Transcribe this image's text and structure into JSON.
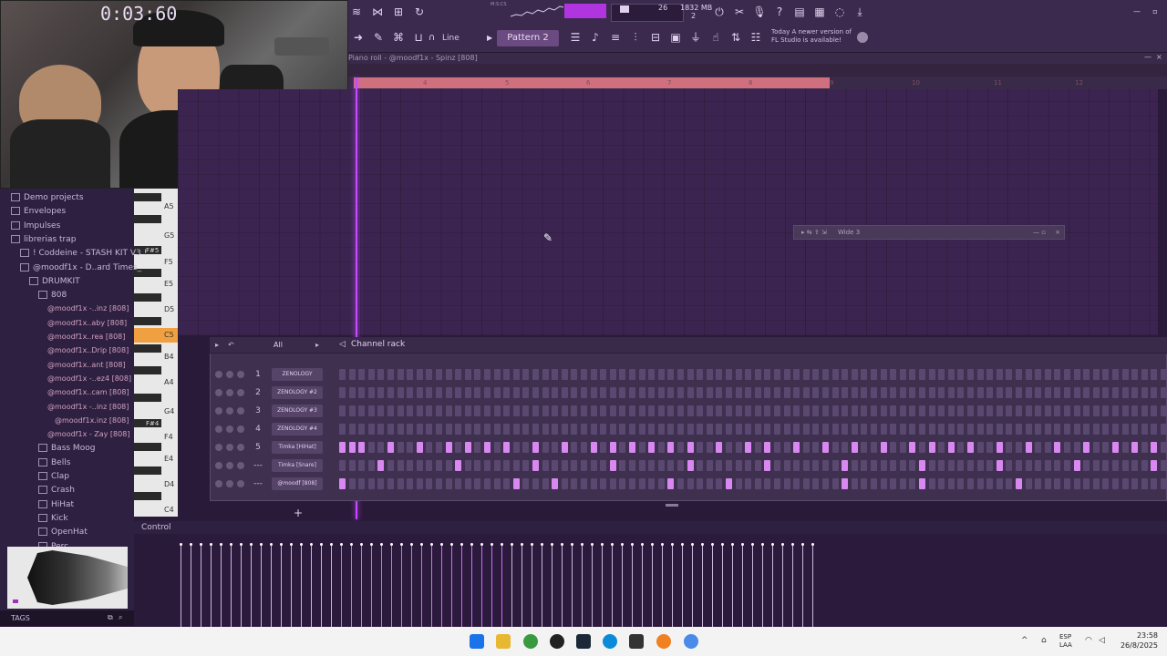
{
  "toolbar": {
    "time": "0:03:60",
    "time_unit": "M:S:CS",
    "pattern": "Pattern 2",
    "snap": "Line",
    "cpu_value": "26",
    "memory": "1832 MB",
    "memory_sub": "2",
    "update_date": "Today",
    "update_msg": "A newer version of FL Studio is available!"
  },
  "pianoroll": {
    "title": "Piano roll - @moodf1x - Spinz [808]",
    "ruler": [
      "4",
      "5",
      "6",
      "7",
      "8",
      "9",
      "10",
      "11",
      "12"
    ],
    "floating_title": "Wide 3"
  },
  "keys": {
    "labels": [
      "A5",
      "G5",
      "F5",
      "E5",
      "D5",
      "C5",
      "B4",
      "A4",
      "G4",
      "F4",
      "E4",
      "D4",
      "C4"
    ],
    "black_labels": [
      "F#5",
      "F#4"
    ]
  },
  "browser": {
    "folders": [
      "Demo projects",
      "Envelopes",
      "Impulses",
      "librerias trap",
      "! Coddeine - STASH KIT V3 !",
      "@moodf1x - D..ard Times_",
      "DRUMKIT",
      "808"
    ],
    "files": [
      "@moodf1x -..inz [808]",
      "@moodf1x..aby [808]",
      "@moodf1x..rea [808]",
      "@moodf1x..Drip [808]",
      "@moodf1x..ant [808]",
      "@moodf1x -..ez4 [808]",
      "@moodf1x..cam [808]",
      "@moodf1x -..inz [808]",
      "@moodf1x.inz [808]",
      "@moodf1x - Zay [808]"
    ],
    "subfolders": [
      "Bass Moog",
      "Bells",
      "Clap",
      "Crash",
      "HiHat",
      "Kick",
      "OpenHat",
      "Perc"
    ],
    "tags_label": "TAGS"
  },
  "rack": {
    "filter": "All",
    "title": "Channel rack",
    "channels": [
      {
        "num": "1",
        "name": "ZENOLOGY"
      },
      {
        "num": "2",
        "name": "ZENOLOGY #2"
      },
      {
        "num": "3",
        "name": "ZENOLOGY #3"
      },
      {
        "num": "4",
        "name": "ZENOLOGY #4"
      },
      {
        "num": "5",
        "name": "Timka [HiHat]"
      },
      {
        "num": "---",
        "name": "Timka [Snare]"
      },
      {
        "num": "---",
        "name": "@moodf [808]"
      }
    ]
  },
  "event": {
    "control_label": "Control"
  },
  "taskbar": {
    "lang_1": "ESP",
    "lang_2": "LAA",
    "time": "23:58",
    "date": "26/8/2025"
  },
  "colors": {
    "accent": "#c84aff",
    "loop_region": "#d0707f",
    "step_on": "#d888f0"
  }
}
